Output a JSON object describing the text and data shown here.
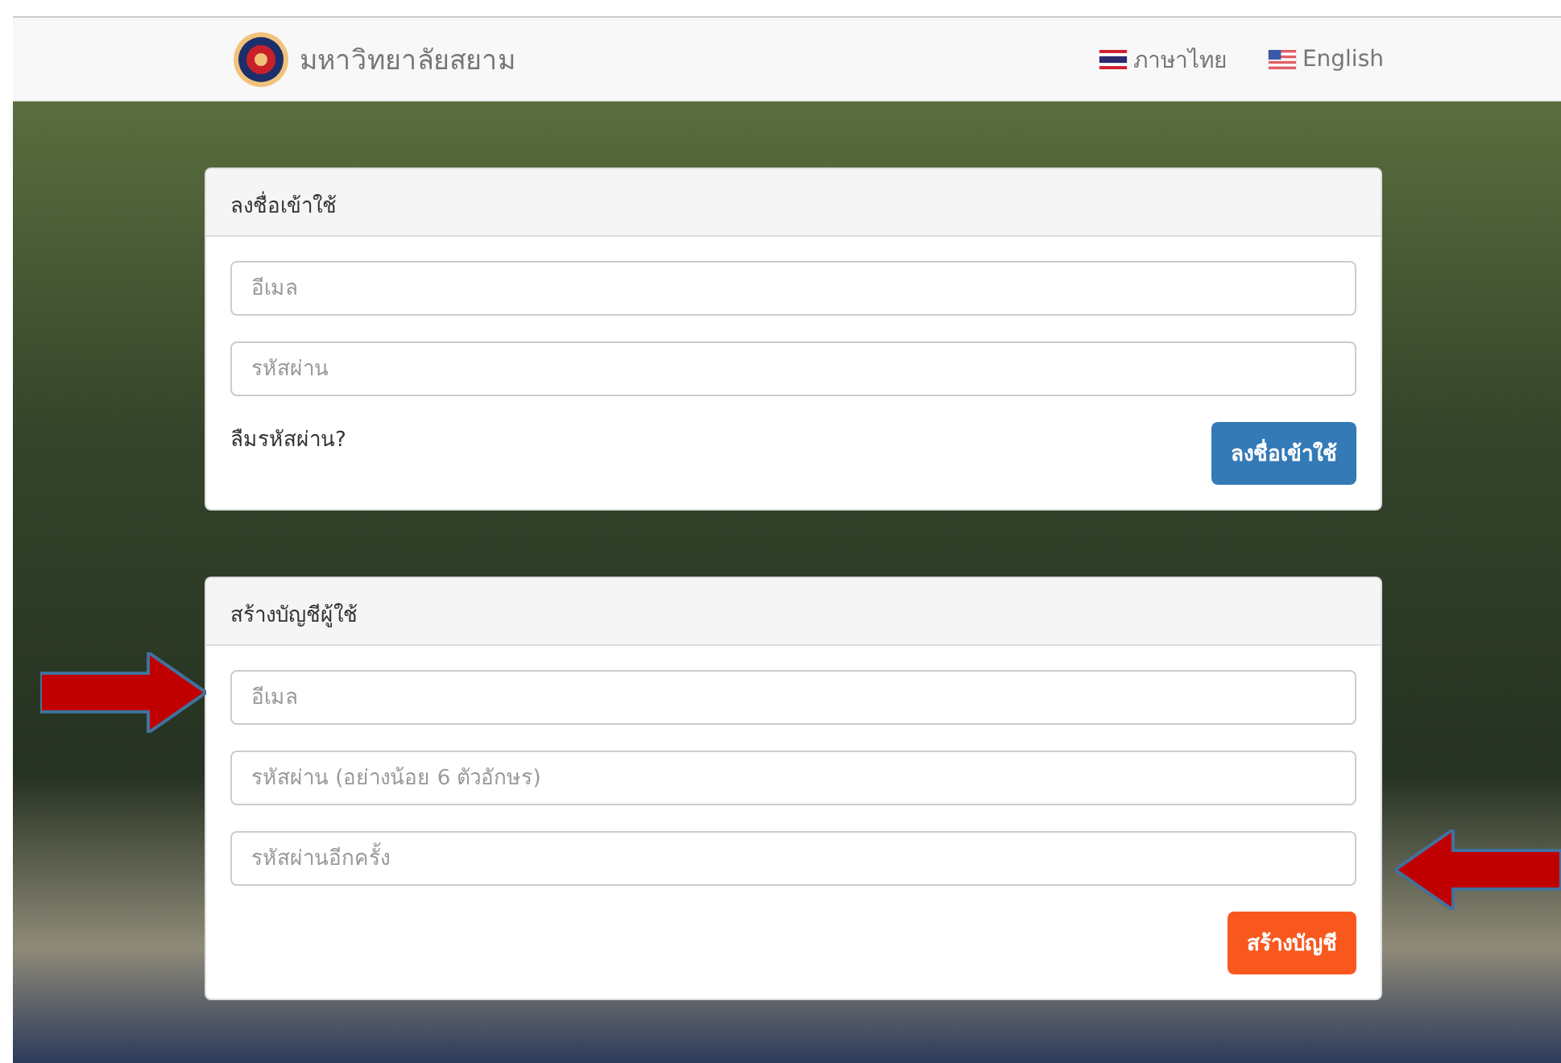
{
  "navbar": {
    "brand": "มหาวิทยาลัยสยาม",
    "languages": [
      {
        "label": "ภาษาไทย",
        "kind": "thai"
      },
      {
        "label": "English",
        "kind": "us"
      }
    ]
  },
  "login": {
    "title": "ลงชื่อเข้าใช้",
    "fields": [
      {
        "placeholder": "อีเมล"
      },
      {
        "placeholder": "รหัสผ่าน"
      }
    ],
    "forgot_link": "ลืมรหัสผ่าน?",
    "button": "ลงชื่อเข้าใช้"
  },
  "register": {
    "title": "สร้างบัญชีผู้ใช้",
    "fields": [
      {
        "placeholder": "อีเมล"
      },
      {
        "placeholder": "รหัสผ่าน (อย่างน้อย 6 ตัวอักษร)"
      },
      {
        "placeholder": "รหัสผ่านอีกครั้ง"
      }
    ],
    "button": "สร้างบัญชี"
  },
  "annotations": [
    {
      "kind": "right"
    },
    {
      "kind": "left"
    }
  ]
}
